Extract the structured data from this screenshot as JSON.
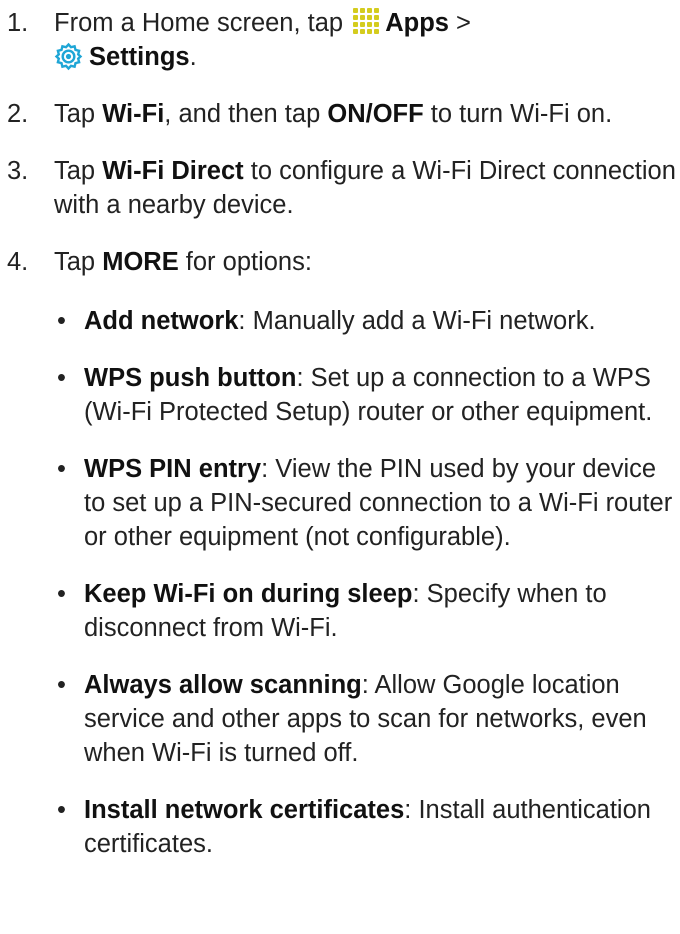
{
  "steps": [
    {
      "number": "1.",
      "line1_prefix": "From a Home screen, tap ",
      "apps_label": "Apps",
      "line1_suffix": " >",
      "settings_label": "Settings",
      "line2_suffix": "."
    },
    {
      "number": "2.",
      "t1": "Tap ",
      "b1": "Wi-Fi",
      "t2": ", and then tap ",
      "b2": "ON/OFF",
      "t3": " to turn Wi-Fi on."
    },
    {
      "number": "3.",
      "t1": "Tap ",
      "b1": "Wi-Fi Direct",
      "t2": " to configure a Wi-Fi Direct connection with a nearby device."
    },
    {
      "number": "4.",
      "t1": "Tap ",
      "b1": "MORE",
      "t2": " for options:"
    }
  ],
  "bullet": "•",
  "options": [
    {
      "name": "Add network",
      "desc": ": Manually add a Wi-Fi network."
    },
    {
      "name": "WPS push button",
      "desc": ": Set up a connection to a WPS (Wi-Fi Protected Setup) router or other equipment."
    },
    {
      "name": "WPS PIN entry",
      "desc": ": View the PIN used by your device to set up a PIN-secured connection to a Wi-Fi router or other equipment (not configurable)."
    },
    {
      "name": "Keep Wi-Fi on during sleep",
      "desc": ": Specify when to disconnect from Wi-Fi."
    },
    {
      "name": "Always allow scanning",
      "desc": ": Allow Google location service and other apps to scan for networks, even when Wi-Fi is turned off."
    },
    {
      "name": "Install network certificates",
      "desc": ": Install authentication certificates."
    }
  ],
  "colors": {
    "apps_icon_grid": "#d4cc1e",
    "settings_icon": "#1fa6d6"
  },
  "icons": [
    "apps-grid-icon",
    "settings-gear-icon"
  ]
}
